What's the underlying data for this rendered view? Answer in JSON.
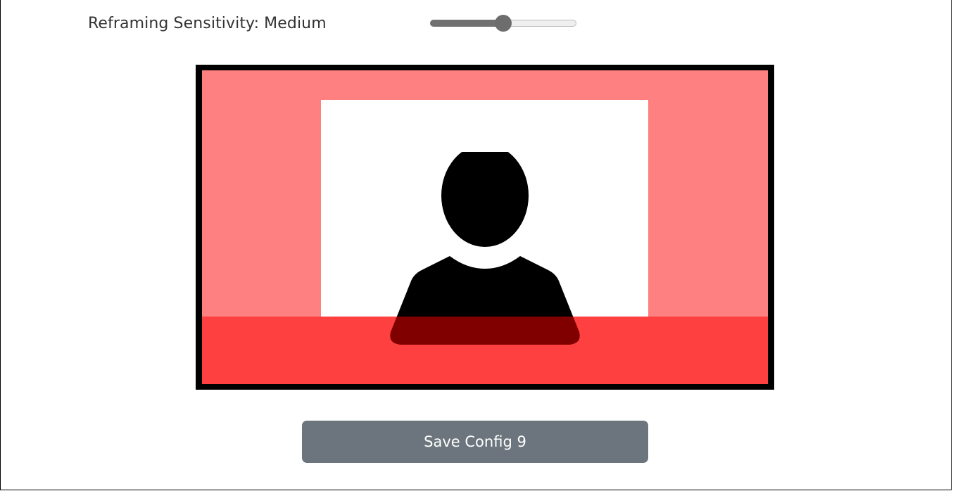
{
  "sensitivity": {
    "label": "Reframing Sensitivity: Medium",
    "slider_fraction": 0.5
  },
  "preview": {
    "frame_color": "#000000",
    "outside_color": "#ff8080",
    "crop_color": "#ffffff",
    "icon": "person-silhouette-icon"
  },
  "actions": {
    "save_label": "Save Config 9",
    "button_color": "#6c757d"
  }
}
